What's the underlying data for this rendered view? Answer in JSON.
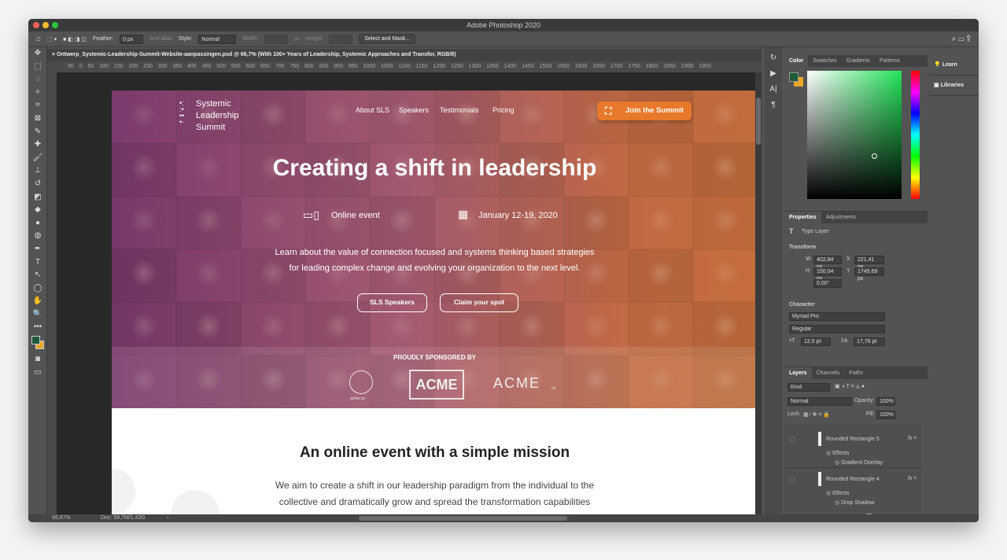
{
  "app": {
    "title": "Adobe Photoshop 2020"
  },
  "options": {
    "feather_label": "Feather:",
    "feather_value": "0 px",
    "antialias": "Anti-alias",
    "style_label": "Style:",
    "style_value": "Normal",
    "width_label": "Width:",
    "height_label": "Height:",
    "select_mask": "Select and Mask..."
  },
  "document": {
    "tab_title": "Ontwerp_Systemic-Leadership-Summit-Website-aanpassingen.psd @ 66,7% (With 100+ Years of Leadership, Systemic Approaches and Transfor, RGB/8)",
    "ruler": "50 0 50 100 150 200 250 300 350 400 450 500 550 600 650 700 750 800 850 900 950 1000 1050 1100 1150 1200 1250 1300 1350 1400 1450 1500 1550 1600 1650 1700 1750 1800 1850 1900 1950"
  },
  "site": {
    "logo": [
      "Systemic",
      "Leadership",
      "Summit"
    ],
    "nav": [
      "About SLS",
      "Speakers",
      "Testimonials",
      "Pricing"
    ],
    "join": "Join the Summit",
    "headline": "Creating a shift in leadership",
    "event_type": "Online event",
    "event_date": "January 12-19, 2020",
    "intro_line1": "Learn about the value of connection focused and systems thinking based strategies",
    "intro_line2": "for leading complex change and evolving your organization to the next level.",
    "btn_speakers": "SLS Speakers",
    "btn_claim": "Claim your spot",
    "sponsored": "PROUDLY SPONSORED BY",
    "sponsors": [
      "acme co",
      "ACME",
      "ACME",
      "co"
    ],
    "mission_title": "An online event with a simple mission",
    "mission_line1": "We aim to create a shift in our leadership paradigm from the individual to the",
    "mission_line2": "collective and dramatically grow and spread the transformation capabilities"
  },
  "color_panel": {
    "tabs": [
      "Color",
      "Swatches",
      "Gradients",
      "Patterns"
    ],
    "fg": "#1f5a37",
    "bg": "#e8a62a"
  },
  "side": {
    "learn": "Learn",
    "libraries": "Libraries"
  },
  "properties": {
    "tabs": [
      "Properties",
      "Adjustments"
    ],
    "layer_type": "Type Layer",
    "transform": "Transform",
    "w": "402,84 px",
    "h": "150,04 px",
    "x": "221,41 px",
    "y": "1749,69 px",
    "angle": "0,00°",
    "character": "Character",
    "font": "Myriad Pro",
    "style": "Regular",
    "size": "12,5 pt",
    "leading": "17,76 pt",
    "wl": "W",
    "hl": "H",
    "xl": "X",
    "yl": "Y"
  },
  "layers": {
    "tabs": [
      "Layers",
      "Channels",
      "Paths"
    ],
    "kind": "Kind",
    "blend": "Normal",
    "opacity_label": "Opacity:",
    "opacity": "100%",
    "lock_label": "Lock:",
    "fill_label": "Fill:",
    "fill": "100%",
    "items": [
      {
        "name": "Rounded Rectangle 5",
        "effects": "Effects",
        "effect": "Gradient Overlay"
      },
      {
        "name": "Rounded Rectangle 4",
        "effects": "Effects",
        "effect": "Drop Shadow"
      }
    ]
  },
  "status": {
    "zoom": "66,67%",
    "doc": "Doc: 59,7M/1,43G"
  }
}
